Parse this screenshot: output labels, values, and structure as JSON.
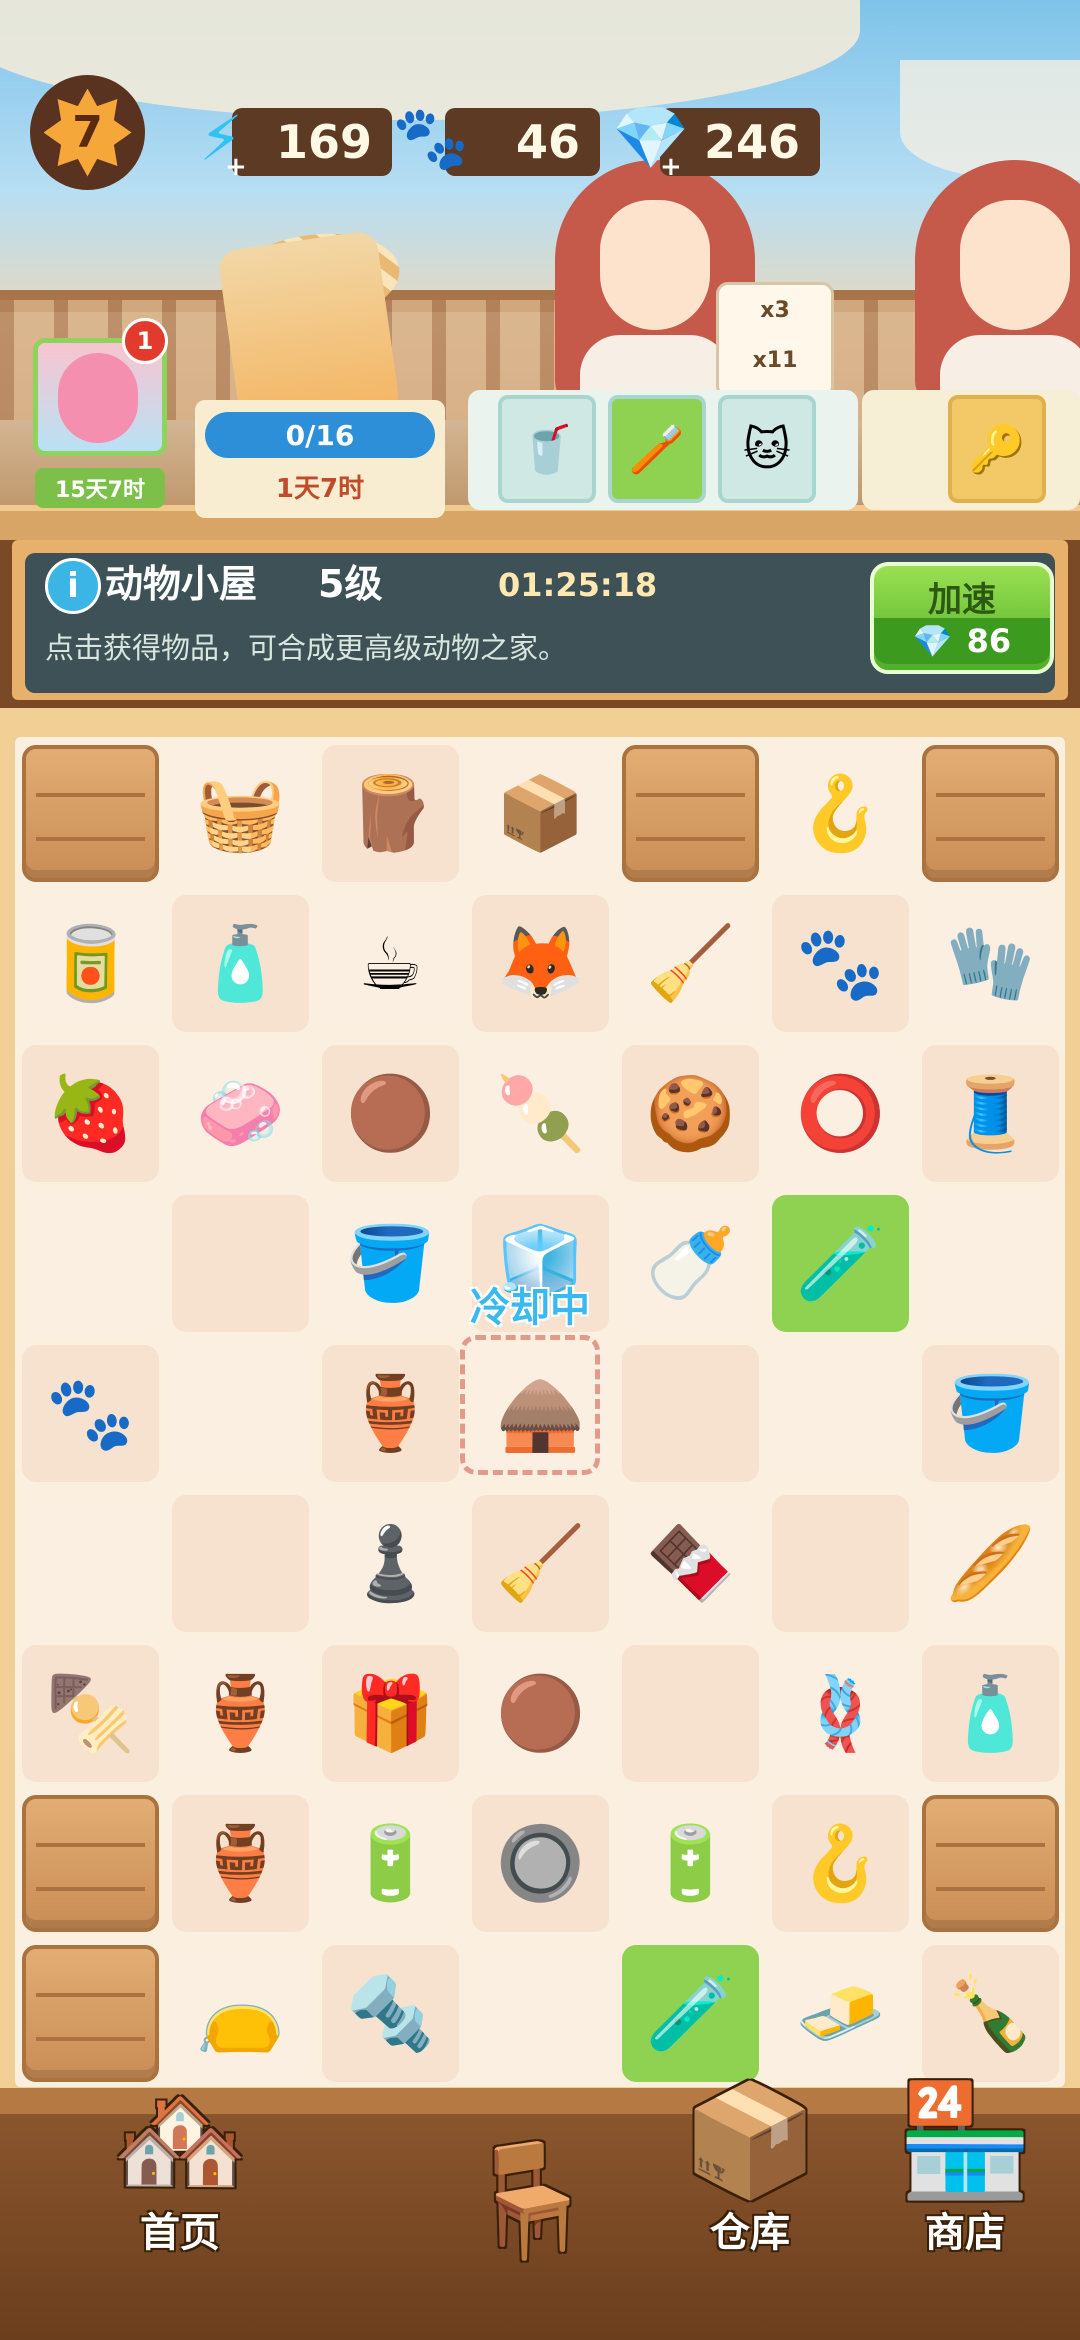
{
  "hud": {
    "level": "7",
    "energy": "169",
    "paws": "46",
    "gems": "246",
    "icons": {
      "energy": "lightning-icon",
      "paws": "paw-icon",
      "gems": "diamond-icon"
    }
  },
  "profile": {
    "badge": "1",
    "timer": "15天7时"
  },
  "order": {
    "progress": "0/16",
    "timer": "1天7时"
  },
  "customer_request": {
    "item1_count": "x3",
    "item2_count": "x11"
  },
  "info": {
    "title": "动物小屋",
    "level": "5级",
    "countdown": "01:25:18",
    "description": "点击获得物品，可合成更高级动物之家。",
    "speed_label": "加速",
    "speed_cost": "86"
  },
  "board": {
    "cooling_label": "冷却中",
    "rows": [
      [
        "crate",
        "🧺",
        "🪵",
        "📦",
        "crate",
        "🪝",
        "crate"
      ],
      [
        "🥫",
        "🧴",
        "☕",
        "🦊",
        "🧹",
        "🐾",
        "🧤"
      ],
      [
        "🍓",
        "🧼",
        "🟤",
        "🍡",
        "🍪",
        "⭕",
        "🧵"
      ],
      [
        "",
        "",
        "🪣",
        "🧊",
        "🍼",
        "🧪",
        ""
      ],
      [
        "🐾",
        "",
        "🏺",
        "🛖",
        "",
        "",
        "🪣"
      ],
      [
        "",
        "",
        "♟️",
        "🧹",
        "🍫",
        "",
        "🥖"
      ],
      [
        "🍢",
        "🏺",
        "🎁",
        "🟤",
        "",
        "🪢",
        "🧴"
      ],
      [
        "crate",
        "🏺",
        "🔋",
        "🔘",
        "🔋",
        "🪝",
        "crate"
      ],
      [
        "crate",
        "👝",
        "🔩",
        "",
        "🧪",
        "🧈",
        "🍾"
      ]
    ],
    "green_cells": [
      "3-5",
      "8-4"
    ],
    "web_cells": [
      "0-1",
      "0-2",
      "0-3",
      "0-5",
      "1-0",
      "1-1",
      "1-4",
      "1-6",
      "2-6",
      "5-6",
      "6-0",
      "6-1",
      "6-6",
      "7-1",
      "7-5",
      "8-1",
      "8-6"
    ]
  },
  "nav": {
    "home": "首页",
    "warehouse": "仓库",
    "shop": "商店"
  }
}
